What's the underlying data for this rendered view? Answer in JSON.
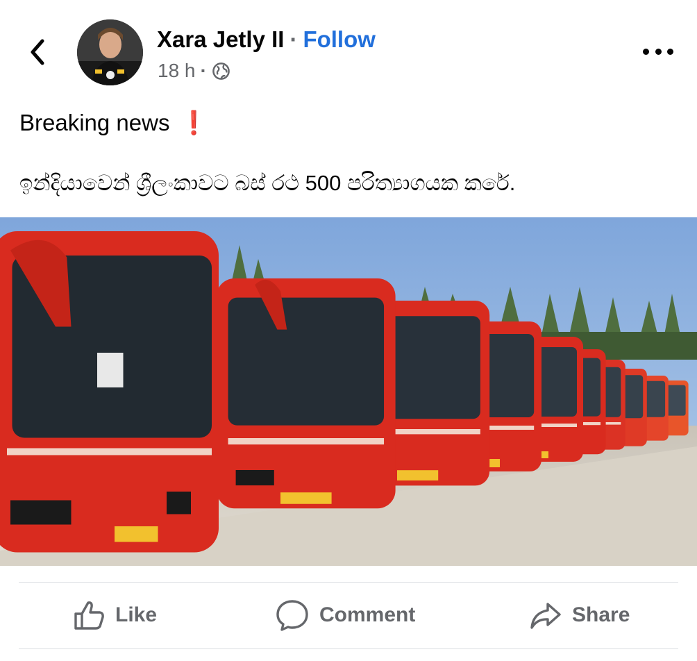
{
  "post": {
    "author": "Xara Jetly II",
    "separator": "·",
    "follow_label": "Follow",
    "time": "18 h",
    "time_separator": "·",
    "privacy_icon": "globe-icon",
    "headline": "Breaking news",
    "headline_emoji": "❗",
    "body": "ඉන්දියාවෙන් ශ්‍රීලංකාවට  බස් රථ 500 පරිත්‍යාගයක කරේ."
  },
  "icons": {
    "back": "chevron-left-icon",
    "more": "more-horizontal-icon"
  },
  "actions": {
    "like_label": "Like",
    "comment_label": "Comment",
    "share_label": "Share"
  },
  "colors": {
    "accent": "#216fdb",
    "secondary_text": "#65676b",
    "emoji_red": "#e41e3f",
    "bus_red": "#d92b1f"
  }
}
